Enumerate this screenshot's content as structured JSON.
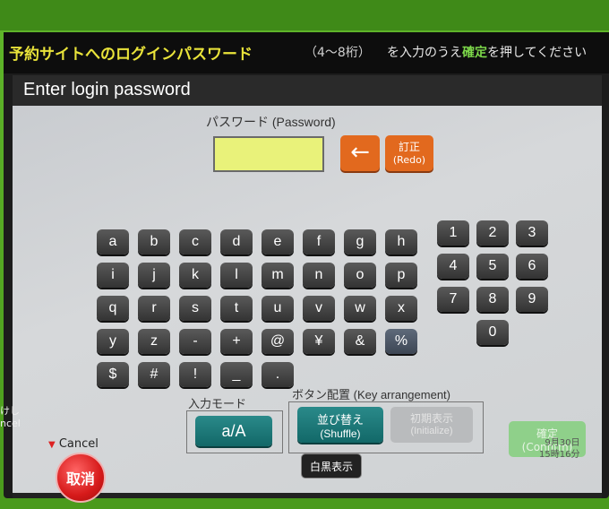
{
  "banner": {
    "instruction_ja": "予約サイトへのログインパスワード",
    "digits": "（4〜8桁）",
    "rest_prefix": "を入力のうえ",
    "confirm_word": "確定",
    "rest_suffix": "を押してください"
  },
  "title": "Enter login password",
  "password_label": "パスワード (Password)",
  "password_value": "",
  "backspace_label": "←",
  "redo": {
    "line1": "訂正",
    "line2": "(Redo)"
  },
  "letters_rows": [
    [
      "a",
      "b",
      "c",
      "d",
      "e",
      "f",
      "g",
      "h"
    ],
    [
      "i",
      "j",
      "k",
      "l",
      "m",
      "n",
      "o",
      "p"
    ],
    [
      "q",
      "r",
      "s",
      "t",
      "u",
      "v",
      "w",
      "x"
    ],
    [
      "y",
      "z",
      "-",
      "+",
      "@",
      "¥",
      "&",
      "%"
    ],
    [
      "$",
      "#",
      "!",
      "_",
      "."
    ]
  ],
  "digits_rows": [
    [
      "1",
      "2",
      "3"
    ],
    [
      "4",
      "5",
      "6"
    ],
    [
      "7",
      "8",
      "9"
    ],
    [
      "0"
    ]
  ],
  "input_mode": {
    "label": "入力モード",
    "button": "a/A"
  },
  "key_arrangement": {
    "label": "ボタン配置 (Key arrangement)",
    "shuffle_line1": "並び替え",
    "shuffle_line2": "(Shuffle)",
    "initialize_line1": "初期表示",
    "initialize_line2": "(Initialize)"
  },
  "confirm": {
    "line1": "確定",
    "line2": "(Confirm)"
  },
  "cancel_hint": "Cancel",
  "cancel_button": "取消",
  "black_white_button": "白黒表示",
  "datetime": {
    "date": "9月30日",
    "time": "15時16分"
  },
  "side_text": {
    "line1": "けし",
    "line2": "ncel"
  }
}
